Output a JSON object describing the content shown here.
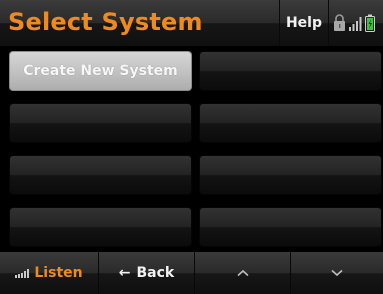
{
  "header": {
    "title": "Select System",
    "help_label": "Help",
    "status_icons": [
      "lock-icon",
      "signal-strength-icon",
      "battery-icon"
    ]
  },
  "systems": {
    "items": [
      {
        "label": "Create New System",
        "selected": true
      },
      {
        "label": "",
        "selected": false
      },
      {
        "label": "",
        "selected": false
      },
      {
        "label": "",
        "selected": false
      },
      {
        "label": "",
        "selected": false
      },
      {
        "label": "",
        "selected": false
      },
      {
        "label": "",
        "selected": false
      },
      {
        "label": "",
        "selected": false
      }
    ]
  },
  "footer": {
    "listen_label": "Listen",
    "back_label": "Back",
    "back_icon": "left-arrow-icon",
    "up_icon": "chevron-up-icon",
    "down_icon": "chevron-down-icon"
  },
  "colors": {
    "accent": "#f08a1e",
    "battery": "#3ec43e",
    "text": "#f2f2f2",
    "background": "#000000"
  }
}
